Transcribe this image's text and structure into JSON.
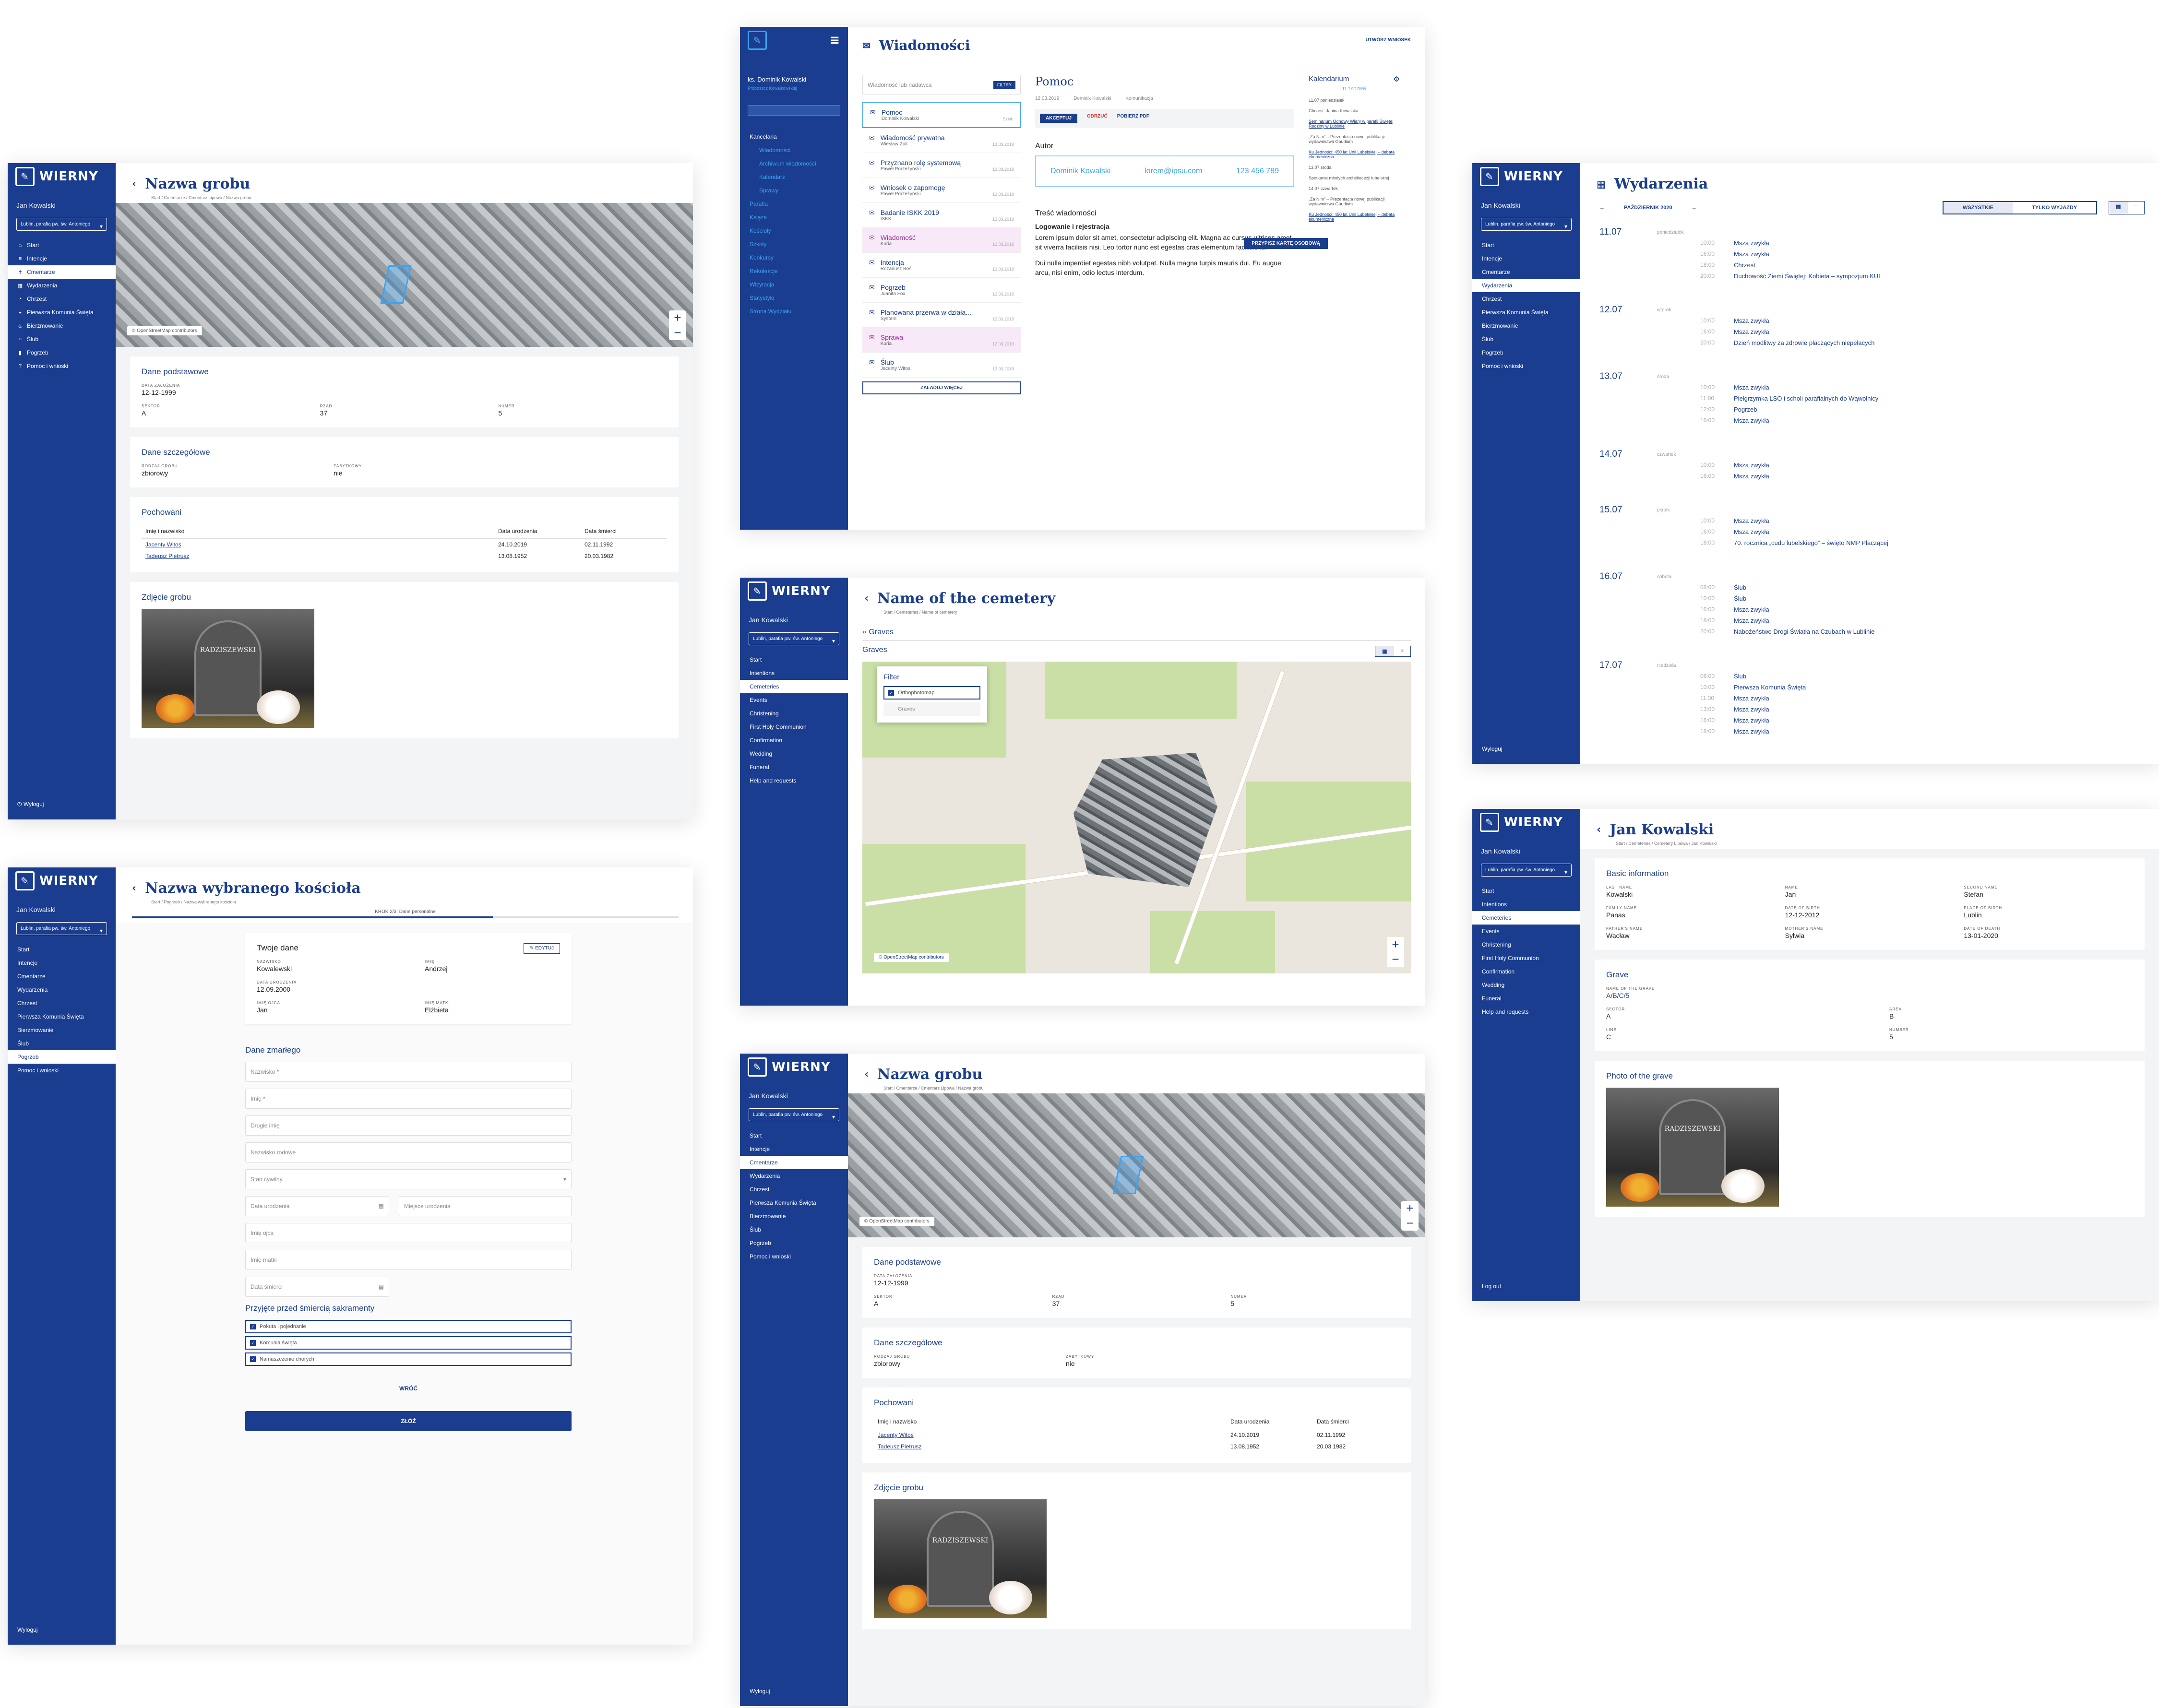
{
  "brand": "WIERNY",
  "user": "Jan Kowalski",
  "parish": "Lublin, parafia pw. św. Antoniego",
  "nav_pl": [
    "Start",
    "Intencje",
    "Cmentarze",
    "Wydarzenia",
    "Chrzest",
    "Pierwsza Komunia Święta",
    "Bierzmowanie",
    "Ślub",
    "Pogrzeb",
    "Pomoc i wnioski"
  ],
  "nav_en": [
    "Start",
    "Intentions",
    "Cemeteries",
    "Events",
    "Christening",
    "First Holy Communion",
    "Confirmation",
    "Wedding",
    "Funeral",
    "Help and requests"
  ],
  "logout_pl": "Wyloguj",
  "logout_en": "Log out",
  "grave": {
    "title": "Nazwa grobu",
    "crumb": "Start / Cmentarze / Cmentarz Lipowa / Nazwa grobu",
    "osm": "© OpenStreetMap contributors",
    "basic": "Dane podstawowe",
    "f_date": "Data założenia",
    "v_date": "12-12-1999",
    "f_sector": "Sektor",
    "v_sector": "A",
    "f_row": "Rząd",
    "v_row": "37",
    "f_num": "Numer",
    "v_num": "5",
    "detail": "Dane szczegółowe",
    "f_type": "Rodzaj grobu",
    "v_type": "zbiorowy",
    "f_walled": "Zabytkowy",
    "v_walled": "nie",
    "buried": "Pochowani",
    "cols": [
      "Imię i nazwisko",
      "Data urodzenia",
      "Data śmierci"
    ],
    "rows": [
      [
        "Jacenty Witos",
        "24.10.2019",
        "02.11.1992"
      ],
      [
        "Tadeusz Pietrusz",
        "13.08.1952",
        "20.03.1982"
      ]
    ],
    "photo": "Zdjęcie grobu",
    "stone": "RADZISZEWSKI"
  },
  "church": {
    "title": "Nazwa wybranego kościoła",
    "crumb": "Start / Pogrzeb / Nazwa wybranego kościoła",
    "step": "KROK 2/3: Dane personalne",
    "yours": "Twoje dane",
    "edit": "EDYTUJ",
    "f_ln": "Nazwisko",
    "v_ln": "Kowalewski",
    "f_fn": "Imię",
    "v_fn": "Andrzej",
    "f_bd": "Data urodzenia",
    "v_bd": "12.09.2000",
    "f_fa": "Imię ojca",
    "v_fa": "Jan",
    "f_mo": "Imię matki",
    "v_mo": "Elżbieta",
    "deceased": "Dane zmarłego",
    "inputs": [
      "Nazwisko *",
      "Imię *",
      "Drugie imię",
      "Nazwisko rodowe",
      "Stan cywilny"
    ],
    "birth": "Data urodzenia",
    "place": "Miejsce urodzenia",
    "father": "Imię ojca",
    "mother": "Imię matki",
    "death": "Data śmierci",
    "sacr": "Przyjęte przed śmiercią sakramenty",
    "checks": [
      "Pokuta i pojednanie",
      "Komunia święta",
      "Namaszczenie chorych"
    ],
    "back": "WRÓĆ",
    "submit": "ZŁÓŻ"
  },
  "messages": {
    "title": "Wiadomości",
    "new": "UTWÓRZ WNIOSEK",
    "user": "ks. Dominik Kowalski",
    "role": "Proboszcz Kowalkowskiej",
    "search": "Wiadomość lub nadawca",
    "filters": "FILTRY",
    "side": [
      "Kancelaria",
      "Wiadomości",
      "Archiwum wiadomości",
      "Kalendarz",
      "Sprawy",
      "Parafia",
      "Księża",
      "Kościoły",
      "Szkoły",
      "Konkursy",
      "Rekolekcje",
      "Wizytacja",
      "Statystyki",
      "Strona Wydziału"
    ],
    "list": [
      [
        "Pomoc",
        "Dominik Kowalski",
        "Szkic"
      ],
      [
        "Wiadomość prywatna",
        "Wiesław Żuk",
        "12.03.2019"
      ],
      [
        "Przyznano rolę systemową",
        "Paweł Porzeżyński",
        "12.03.2019"
      ],
      [
        "Wniosek o zapomogę",
        "Paweł Porzeżyński",
        "12.03.2019"
      ],
      [
        "Badanie ISKK 2019",
        "ISKK",
        "12.03.2019"
      ],
      [
        "Wiadomość",
        "Kuria",
        "12.03.2019"
      ],
      [
        "Intencja",
        "Rozariusz Boś",
        "12.03.2019"
      ],
      [
        "Pogrzeb",
        "Juanita Fox",
        "12.03.2019"
      ],
      [
        "Planowana przerwa w działa...",
        "System",
        "12.03.2019"
      ],
      [
        "Sprawa",
        "Kuria",
        "12.03.2019"
      ],
      [
        "Ślub",
        "Jacenty Witos",
        "12.03.2019"
      ]
    ],
    "more": "ZAŁADUJ WIĘCEJ",
    "subject": "Pomoc",
    "date": "12.03.2019",
    "from": "Dominik Kowalski",
    "type": "Komunikacja",
    "accept": "AKCEPTUJ",
    "reject": "ODRZUĆ",
    "pdf": "POBIERZ PDF",
    "author": "Autor",
    "email": "lorem@ipsu.com",
    "phone": "123 456 789",
    "assign": "PRZYPISZ KARTĘ OSOBOWĄ",
    "content": "Treść wiadomości",
    "c1": "Logowanie i rejestracja",
    "c2": "Lorem ipsum dolor sit amet, consectetur adipiscing elit. Magna ac cursus ultrices amet sit viverra facilisis nisi. Leo tortor nunc est egestas cras elementum facilisis id.",
    "c3": "Dui nulla imperdiet egestas nibh volutpat. Nulla magna turpis mauris dui. Eu augue arcu, nisi enim, odio lectus interdum.",
    "cal": "Kalendarium",
    "week": "11 TYDZIEŃ",
    "calitems": [
      "11.07 poniedziałek",
      "Chrzest: Janina Kowalska",
      "Seminarium Odnowy Wiary w parafii Świętej Rodziny w Lublinie",
      "„Za Nim” – Prezentacja nowej publikacji wydawnictwa Gaudium",
      "Ku Jedności: 450 lat Unii Lubelskiej – debata ekumeniczna",
      "13.07 środa",
      "Spotkanie młodych archidiecezji lubelskiej",
      "14.07 czwartek",
      "„Za Nim” – Prezentacja nowej publikacji wydawnictwa Gaudium",
      "Ku Jedności: 450 lat Unii Lubelskiej – debata ekumeniczna"
    ]
  },
  "cemetery": {
    "title": "Name of the cemetery",
    "crumb": "Start / Cemeteries / Name of cemetery",
    "search": "Graves",
    "graves": "Graves",
    "filter": "Filter",
    "o1": "Orthophotomap",
    "o2": "Graves",
    "osm": "© OpenStreetMap contributors"
  },
  "events": {
    "title": "Wydarzenia",
    "month": "PAŹDZIERNIK 2020",
    "all": "WSZYSTKIE",
    "trips": "TYLKO WYJAZDY",
    "days": [
      {
        "d": "11.07",
        "w": "poniedziałek",
        "items": [
          [
            "10:00",
            "Msza zwykła"
          ],
          [
            "16:00",
            "Msza zwykła"
          ],
          [
            "18:00",
            "Chrzest"
          ],
          [
            "20:00",
            "Duchowość Ziemi Świętej: Kobieta – sympozjum KUL"
          ]
        ]
      },
      {
        "d": "12.07",
        "w": "wtorek",
        "items": [
          [
            "10:00",
            "Msza zwykła"
          ],
          [
            "16:00",
            "Msza zwykła"
          ],
          [
            "20:00",
            "Dzień modlitwy za zdrowie płaczących niepełacych"
          ]
        ]
      },
      {
        "d": "13.07",
        "w": "środa",
        "items": [
          [
            "10:00",
            "Msza zwykła"
          ],
          [
            "11:00",
            "Pielgrzymka LSO i scholi parafialnych do Wąwolnicy"
          ],
          [
            "12:00",
            "Pogrzeb"
          ],
          [
            "16:00",
            "Msza zwykła"
          ]
        ]
      },
      {
        "d": "14.07",
        "w": "czwartek",
        "items": [
          [
            "10:00",
            "Msza zwykła"
          ],
          [
            "16:00",
            "Msza zwykła"
          ]
        ]
      },
      {
        "d": "15.07",
        "w": "piątek",
        "items": [
          [
            "10:00",
            "Msza zwykła"
          ],
          [
            "16:00",
            "Msza zwykła"
          ],
          [
            "18:00",
            "70. rocznica „cudu lubelskiego” – święto NMP Płaczącej"
          ]
        ]
      },
      {
        "d": "16.07",
        "w": "sobota",
        "items": [
          [
            "08:00",
            "Ślub"
          ],
          [
            "10:00",
            "Ślub"
          ],
          [
            "16:00",
            "Msza zwykła"
          ],
          [
            "18:00",
            "Msza zwykła"
          ],
          [
            "20:00",
            "Nabożeństwo Drogi Światła na Czubach w Lublinie"
          ]
        ]
      },
      {
        "d": "17.07",
        "w": "niedziela",
        "items": [
          [
            "08:00",
            "Ślub"
          ],
          [
            "10:00",
            "Pierwsza Komunia Święta"
          ],
          [
            "11:30",
            "Msza zwykła"
          ],
          [
            "13:00",
            "Msza zwykła"
          ],
          [
            "16:00",
            "Msza zwykła"
          ],
          [
            "18:00",
            "Msza zwykła"
          ]
        ]
      }
    ]
  },
  "person": {
    "title": "Jan Kowalski",
    "crumb": "Start / Cemeteries / Cemetery Lipowa / Jan Kowalski",
    "basic": "Basic information",
    "f": [
      [
        "Last name",
        "Kowalski"
      ],
      [
        "Name",
        "Jan"
      ],
      [
        "Second name",
        "Stefan"
      ],
      [
        "Family name",
        "Panas"
      ],
      [
        "Date of birth",
        "12-12-2012"
      ],
      [
        "Place of birth",
        "Lublin"
      ],
      [
        "Father's name",
        "Wacław"
      ],
      [
        "Mother's name",
        "Sylwia"
      ],
      [
        "Date of death",
        "13-01-2020"
      ]
    ],
    "grave": "Grave",
    "f_gn": "Name of the grave",
    "v_gn": "A/B/C/5",
    "f_sec": "Sector",
    "v_sec": "A",
    "f_area": "Area",
    "v_area": "B",
    "f_line": "Line",
    "v_line": "C",
    "f_num": "Number",
    "v_num": "5",
    "photo": "Photo of the grave"
  }
}
